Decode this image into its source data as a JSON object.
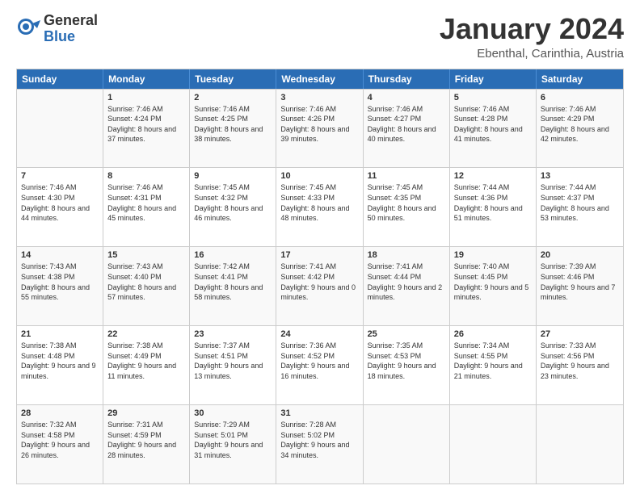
{
  "logo": {
    "general": "General",
    "blue": "Blue"
  },
  "header": {
    "month": "January 2024",
    "location": "Ebenthal, Carinthia, Austria"
  },
  "days": [
    "Sunday",
    "Monday",
    "Tuesday",
    "Wednesday",
    "Thursday",
    "Friday",
    "Saturday"
  ],
  "weeks": [
    [
      {
        "day": "",
        "empty": true
      },
      {
        "day": "1",
        "sunrise": "7:46 AM",
        "sunset": "4:24 PM",
        "daylight": "8 hours and 37 minutes."
      },
      {
        "day": "2",
        "sunrise": "7:46 AM",
        "sunset": "4:25 PM",
        "daylight": "8 hours and 38 minutes."
      },
      {
        "day": "3",
        "sunrise": "7:46 AM",
        "sunset": "4:26 PM",
        "daylight": "8 hours and 39 minutes."
      },
      {
        "day": "4",
        "sunrise": "7:46 AM",
        "sunset": "4:27 PM",
        "daylight": "8 hours and 40 minutes."
      },
      {
        "day": "5",
        "sunrise": "7:46 AM",
        "sunset": "4:28 PM",
        "daylight": "8 hours and 41 minutes."
      },
      {
        "day": "6",
        "sunrise": "7:46 AM",
        "sunset": "4:29 PM",
        "daylight": "8 hours and 42 minutes."
      }
    ],
    [
      {
        "day": "7",
        "sunrise": "7:46 AM",
        "sunset": "4:30 PM",
        "daylight": "8 hours and 44 minutes."
      },
      {
        "day": "8",
        "sunrise": "7:46 AM",
        "sunset": "4:31 PM",
        "daylight": "8 hours and 45 minutes."
      },
      {
        "day": "9",
        "sunrise": "7:45 AM",
        "sunset": "4:32 PM",
        "daylight": "8 hours and 46 minutes."
      },
      {
        "day": "10",
        "sunrise": "7:45 AM",
        "sunset": "4:33 PM",
        "daylight": "8 hours and 48 minutes."
      },
      {
        "day": "11",
        "sunrise": "7:45 AM",
        "sunset": "4:35 PM",
        "daylight": "8 hours and 50 minutes."
      },
      {
        "day": "12",
        "sunrise": "7:44 AM",
        "sunset": "4:36 PM",
        "daylight": "8 hours and 51 minutes."
      },
      {
        "day": "13",
        "sunrise": "7:44 AM",
        "sunset": "4:37 PM",
        "daylight": "8 hours and 53 minutes."
      }
    ],
    [
      {
        "day": "14",
        "sunrise": "7:43 AM",
        "sunset": "4:38 PM",
        "daylight": "8 hours and 55 minutes."
      },
      {
        "day": "15",
        "sunrise": "7:43 AM",
        "sunset": "4:40 PM",
        "daylight": "8 hours and 57 minutes."
      },
      {
        "day": "16",
        "sunrise": "7:42 AM",
        "sunset": "4:41 PM",
        "daylight": "8 hours and 58 minutes."
      },
      {
        "day": "17",
        "sunrise": "7:41 AM",
        "sunset": "4:42 PM",
        "daylight": "9 hours and 0 minutes."
      },
      {
        "day": "18",
        "sunrise": "7:41 AM",
        "sunset": "4:44 PM",
        "daylight": "9 hours and 2 minutes."
      },
      {
        "day": "19",
        "sunrise": "7:40 AM",
        "sunset": "4:45 PM",
        "daylight": "9 hours and 5 minutes."
      },
      {
        "day": "20",
        "sunrise": "7:39 AM",
        "sunset": "4:46 PM",
        "daylight": "9 hours and 7 minutes."
      }
    ],
    [
      {
        "day": "21",
        "sunrise": "7:38 AM",
        "sunset": "4:48 PM",
        "daylight": "9 hours and 9 minutes."
      },
      {
        "day": "22",
        "sunrise": "7:38 AM",
        "sunset": "4:49 PM",
        "daylight": "9 hours and 11 minutes."
      },
      {
        "day": "23",
        "sunrise": "7:37 AM",
        "sunset": "4:51 PM",
        "daylight": "9 hours and 13 minutes."
      },
      {
        "day": "24",
        "sunrise": "7:36 AM",
        "sunset": "4:52 PM",
        "daylight": "9 hours and 16 minutes."
      },
      {
        "day": "25",
        "sunrise": "7:35 AM",
        "sunset": "4:53 PM",
        "daylight": "9 hours and 18 minutes."
      },
      {
        "day": "26",
        "sunrise": "7:34 AM",
        "sunset": "4:55 PM",
        "daylight": "9 hours and 21 minutes."
      },
      {
        "day": "27",
        "sunrise": "7:33 AM",
        "sunset": "4:56 PM",
        "daylight": "9 hours and 23 minutes."
      }
    ],
    [
      {
        "day": "28",
        "sunrise": "7:32 AM",
        "sunset": "4:58 PM",
        "daylight": "9 hours and 26 minutes."
      },
      {
        "day": "29",
        "sunrise": "7:31 AM",
        "sunset": "4:59 PM",
        "daylight": "9 hours and 28 minutes."
      },
      {
        "day": "30",
        "sunrise": "7:29 AM",
        "sunset": "5:01 PM",
        "daylight": "9 hours and 31 minutes."
      },
      {
        "day": "31",
        "sunrise": "7:28 AM",
        "sunset": "5:02 PM",
        "daylight": "9 hours and 34 minutes."
      },
      {
        "day": "",
        "empty": true
      },
      {
        "day": "",
        "empty": true
      },
      {
        "day": "",
        "empty": true
      }
    ]
  ]
}
